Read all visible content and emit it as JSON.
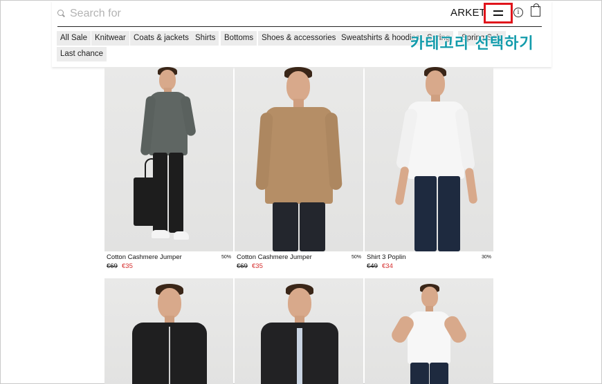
{
  "search": {
    "placeholder": "Search for"
  },
  "header": {
    "brand": "ARKET"
  },
  "icons": {
    "search": "search-icon",
    "menu": "menu-icon",
    "info": "info-icon",
    "bag": "shopping-bag-icon"
  },
  "categories": [
    "All Sale",
    "Knitwear",
    "Coats & jackets",
    "Shirts",
    "Bottoms",
    "Shoes & accessories",
    "Sweatshirts & hoodies",
    "Spring",
    "Spring Sale",
    "Last chance"
  ],
  "annotation": {
    "label": "카테고리 선택하기",
    "highlight_color": "#e0141b",
    "label_color": "#129bab"
  },
  "products": [
    {
      "name": "Cotton Cashmere Jumper",
      "discount": "50%",
      "old_price": "€69",
      "new_price": "€35"
    },
    {
      "name": "Cotton Cashmere Jumper",
      "discount": "50%",
      "old_price": "€69",
      "new_price": "€35"
    },
    {
      "name": "Shirt 3 Poplin",
      "discount": "30%",
      "old_price": "€49",
      "new_price": "€34"
    }
  ],
  "colors": {
    "sale_price": "#d52b2b",
    "chip_bg": "#ececec"
  }
}
